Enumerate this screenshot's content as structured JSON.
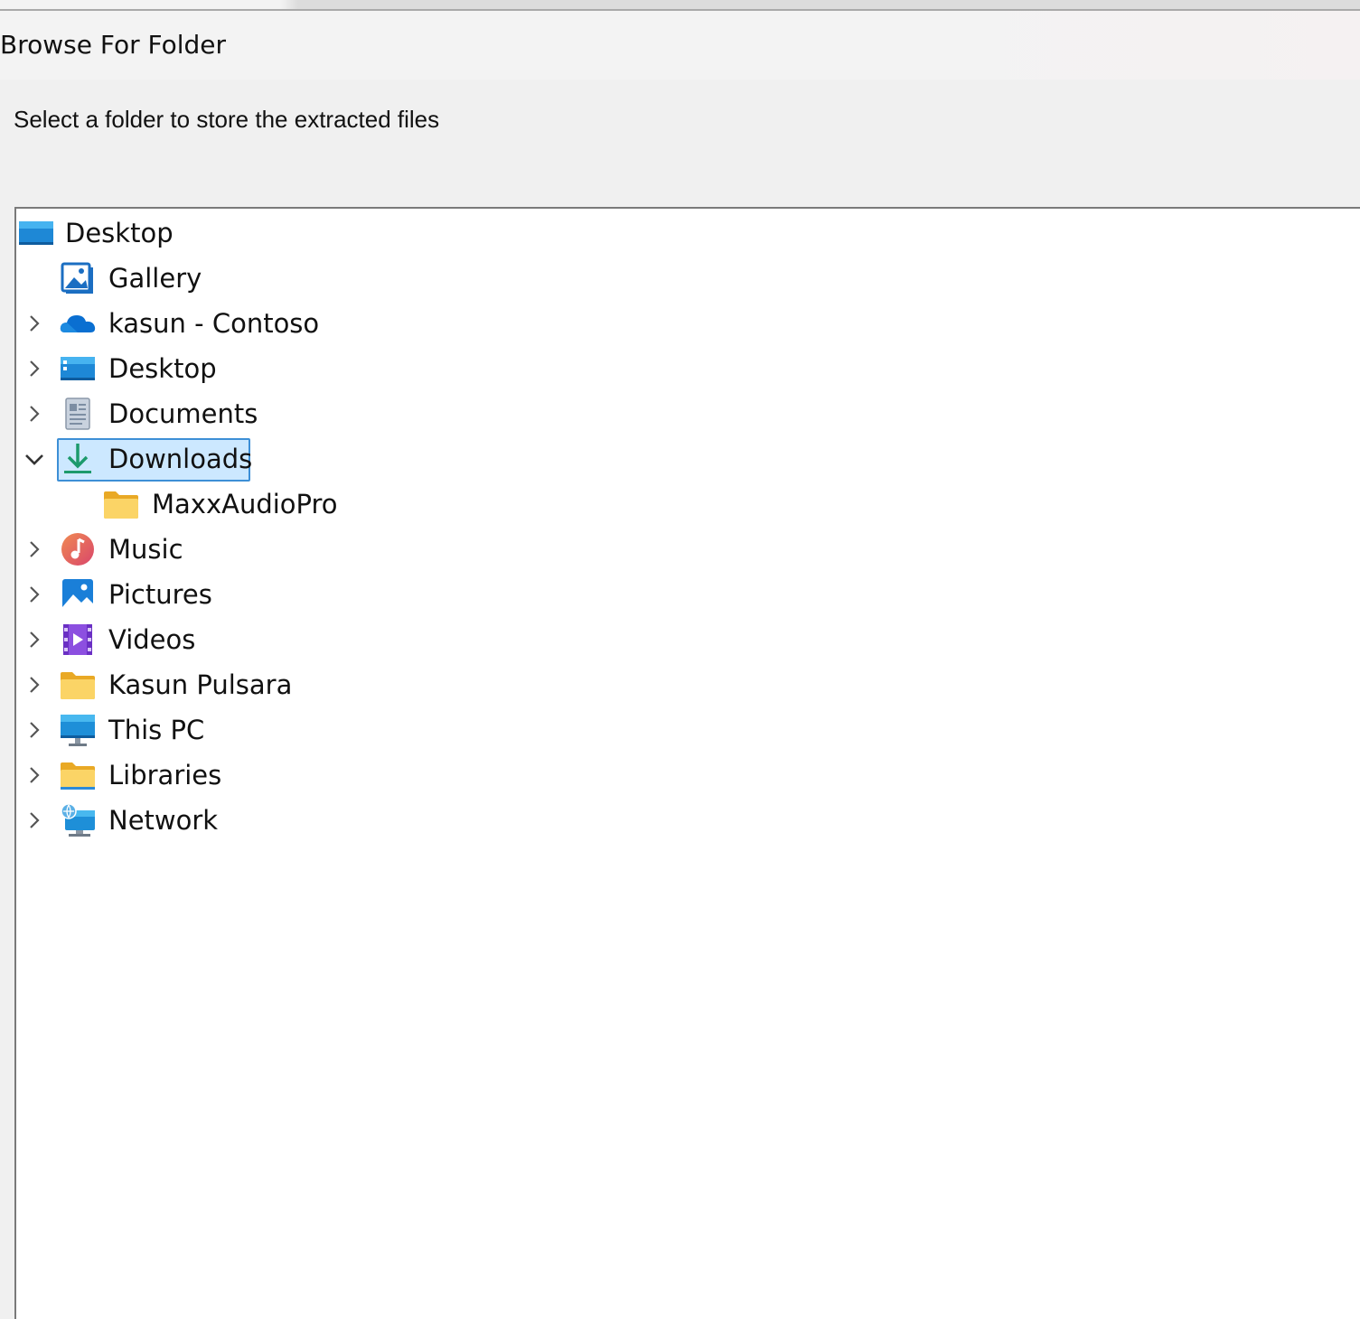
{
  "dialog": {
    "title": "Browse For Folder",
    "instruction": "Select a folder to store the extracted files"
  },
  "tree": {
    "items": [
      {
        "label": "Desktop",
        "icon": "desktop-icon",
        "expander": "none"
      },
      {
        "label": "Gallery",
        "icon": "gallery-icon",
        "expander": "none"
      },
      {
        "label": "kasun - Contoso",
        "icon": "onedrive-cloud-icon",
        "expander": "collapsed"
      },
      {
        "label": "Desktop",
        "icon": "desktop-icon",
        "expander": "collapsed"
      },
      {
        "label": "Documents",
        "icon": "documents-icon",
        "expander": "collapsed"
      },
      {
        "label": "Downloads",
        "icon": "download-arrow-icon",
        "expander": "expanded",
        "selected": true
      },
      {
        "label": "MaxxAudioPro",
        "icon": "folder-icon",
        "expander": "none"
      },
      {
        "label": "Music",
        "icon": "music-icon",
        "expander": "collapsed"
      },
      {
        "label": "Pictures",
        "icon": "pictures-icon",
        "expander": "collapsed"
      },
      {
        "label": "Videos",
        "icon": "videos-icon",
        "expander": "collapsed"
      },
      {
        "label": "Kasun Pulsara",
        "icon": "folder-icon",
        "expander": "collapsed"
      },
      {
        "label": "This PC",
        "icon": "monitor-icon",
        "expander": "collapsed"
      },
      {
        "label": "Libraries",
        "icon": "libraries-folder-icon",
        "expander": "collapsed"
      },
      {
        "label": "Network",
        "icon": "network-icon",
        "expander": "collapsed"
      }
    ]
  },
  "colors": {
    "selection_fill": "#cce8ff",
    "selection_border": "#3d8fd6",
    "folder_yellow": "#f8c94a",
    "accent_blue": "#0a78d4"
  }
}
